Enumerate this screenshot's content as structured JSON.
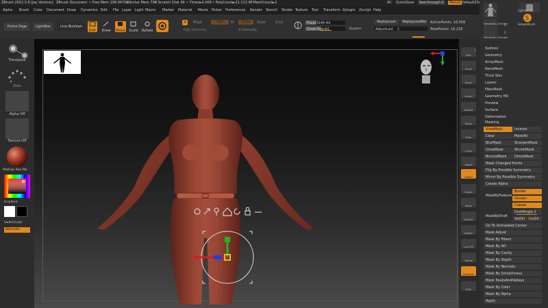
{
  "titlebar": {
    "app_title": "ZBrush 2022.0.8 [Jay Versluis]",
    "document": "ZBrush Document",
    "free_mem": "• Free Mem 108.947GB",
    "active_mem": "• Active Mem 700",
    "scratch_disk": "• Scratch Disk 49",
    "timer": "• Timer►0.009",
    "polycount": "• PolyCount►21.113 KP",
    "meshcount": "• MeshCount►2",
    "ac": "AC",
    "quicksave": "QuickSave",
    "see_through": "See-through",
    "see_through_value": "0",
    "menus": "Menus",
    "default_zscript": "DefaultZScript"
  },
  "menubar": [
    "Alpha",
    "Brush",
    "Color",
    "Document",
    "Draw",
    "Dynamics",
    "Edit",
    "File",
    "Layer",
    "Light",
    "Macro",
    "Marker",
    "Material",
    "Movie",
    "Picker",
    "Preferences",
    "Render",
    "Stencil",
    "Stroke",
    "Texture",
    "Tool",
    "Transform",
    "Zplugin",
    "Zscript",
    "Help"
  ],
  "toolshelf": {
    "home_page": "Home Page",
    "lightbox": "LightBox",
    "live_boolean": "Live Boolean",
    "edit": "Edit",
    "draw": "Draw",
    "move": "Move",
    "scale": "Scale",
    "rotate": "Rotate",
    "a_label": "A",
    "mrgb": "Mrgb",
    "rgb": "Rgb",
    "m": "M",
    "zadd": "Zadd",
    "zsub": "Zsub",
    "zcut": "Zcut",
    "rgb_intensity": "Rgb Intensity",
    "z_intensity": "Z Intensity",
    "focal_shift_label": "Focal Shift",
    "focal_shift_value": "-44",
    "draw_size_label": "Draw Size",
    "draw_size_value": "64",
    "dynamic": "Dynamic",
    "replay_last": "ReplayLast",
    "replay_last_rel": "ReplayLastRel",
    "adjust_last_label": "AdjustLast",
    "adjust_last_value": "1",
    "active_points_label": "ActivePoints:",
    "active_points_value": "16.556",
    "total_points_label": "TotalPoints:",
    "total_points_value": "16.229"
  },
  "leftpanel": {
    "transpose": "Transpose",
    "dots": "Dots",
    "alpha_off": "Alpha Off",
    "texture_off": "Texture Off",
    "matcap": "MatCap Red Wa",
    "gradient": "Gradient",
    "switch_color": "SwitchColor",
    "alternate": "Alternate"
  },
  "rightstrip": [
    "SPix",
    "Scroll",
    "Zoom",
    "Actual",
    "AAHalf",
    "Persp",
    "Floor",
    "L.Sym",
    "Xpose",
    "Gizmo",
    "Frame",
    "Move",
    "ZoomD",
    "Rotate",
    "Line Fill",
    "Transp",
    "Dynamic",
    "Solo"
  ],
  "rightstrip_spix_value": "3",
  "rightpanel": {
    "thumb_label_top": "Cylinder3D",
    "thumb_label_1": "Genesis8_1Female",
    "thumb_label_2": "SimpleBrush",
    "thumb_label_3": "Genesis8_1Female",
    "thumb_count_1": "2",
    "thumb_count_2": "2",
    "sections": [
      "Subtool",
      "Geometry",
      "ArrayMesh",
      "NanoMesh",
      "Thick Skin",
      "Layers",
      "FiberMesh",
      "Geometry HD",
      "Preview",
      "Surface",
      "Deformation",
      "Masking"
    ],
    "masking": {
      "viewmask": "ViewMask",
      "inverse": "Inverse",
      "clear": "Clear",
      "maskall": "MaskAll",
      "blurmask": "BlurMask",
      "sharpenmask": "SharpenMask",
      "growmask": "GrowMask",
      "shrinkmask": "ShrinkMask",
      "borrowmask": "BorrowMask",
      "dilutemask": "DiluteMask",
      "mask_changed_points": "Mask Changed Points",
      "flip_by_symmetry": "Flip By Possible Symmetry",
      "mirror_by_symmetry": "Mirror By Possible Symmetry",
      "create_alpha": "Create Alpha",
      "mask_by_feature": "MaskByFeature",
      "border": "Border",
      "groups": "Groups",
      "crease": "Crease",
      "draft_angle_label": "DraftAngle",
      "draft_angle_value": "2",
      "mask_by_draft": "MaskByDraft",
      "setdir": "SetDir",
      "invdir": "InvDir",
      "go_to_unmasked_center": "Go To Unmasked Center",
      "list": [
        "Mask Adjust",
        "Mask By Fibers",
        "Mask By AO",
        "Mask By Cavity",
        "Mask By Depth",
        "Mask By Normals",
        "Mask By Smoothness",
        "Mask PeaksAndValleys",
        "Mask By Color",
        "Mask By Alpha",
        "Apply"
      ]
    }
  },
  "colors": {
    "accent": "#e08a1e",
    "skin": "#8a3a2e",
    "gizmo_green": "#22b222",
    "gizmo_red": "#d02020",
    "gizmo_blue": "#2040e0",
    "gizmo_yellow": "#e0c020"
  }
}
